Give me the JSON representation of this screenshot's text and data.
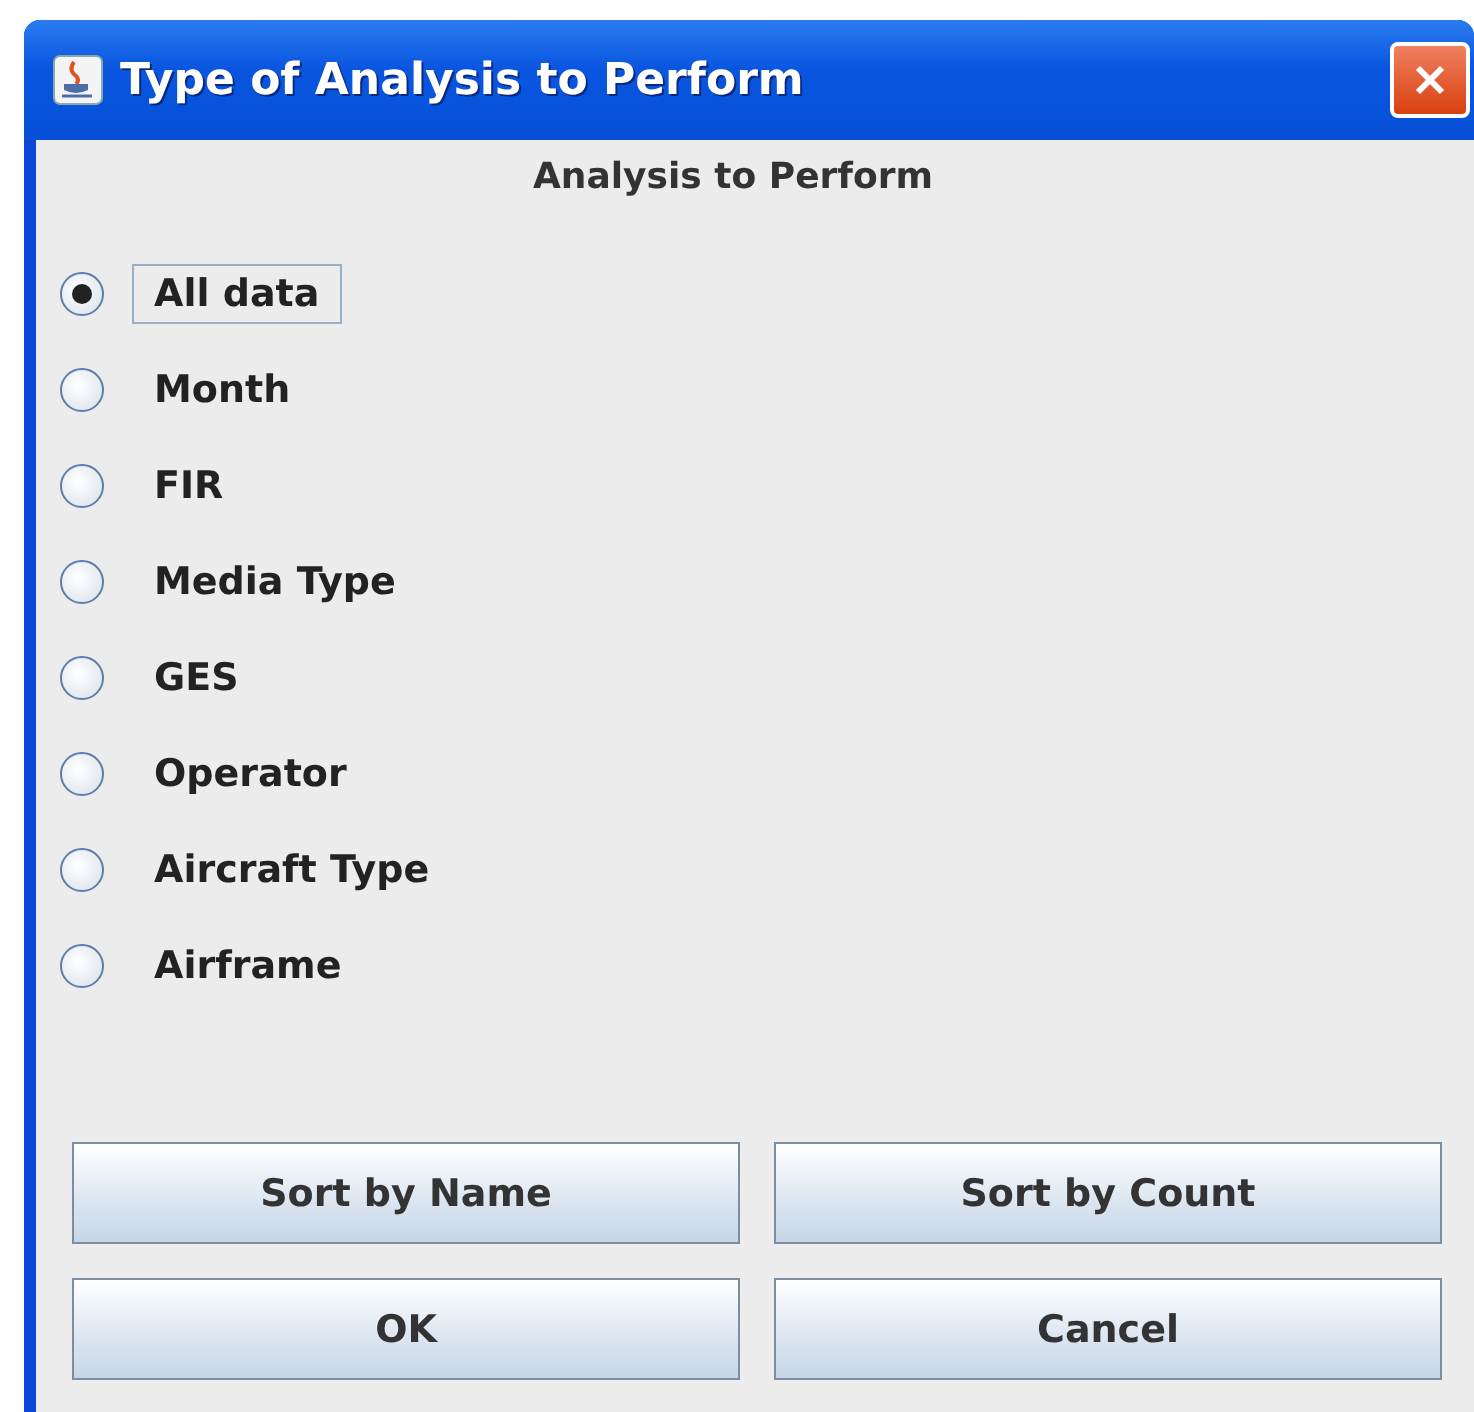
{
  "window": {
    "title": "Type of Analysis to Perform"
  },
  "heading": "Analysis to Perform",
  "options": [
    {
      "label": "All data",
      "selected": true
    },
    {
      "label": "Month",
      "selected": false
    },
    {
      "label": "FIR",
      "selected": false
    },
    {
      "label": "Media Type",
      "selected": false
    },
    {
      "label": "GES",
      "selected": false
    },
    {
      "label": "Operator",
      "selected": false
    },
    {
      "label": "Aircraft Type",
      "selected": false
    },
    {
      "label": "Airframe",
      "selected": false
    }
  ],
  "buttons": [
    "Sort by Name",
    "Sort by Count",
    "OK",
    "Cancel"
  ]
}
